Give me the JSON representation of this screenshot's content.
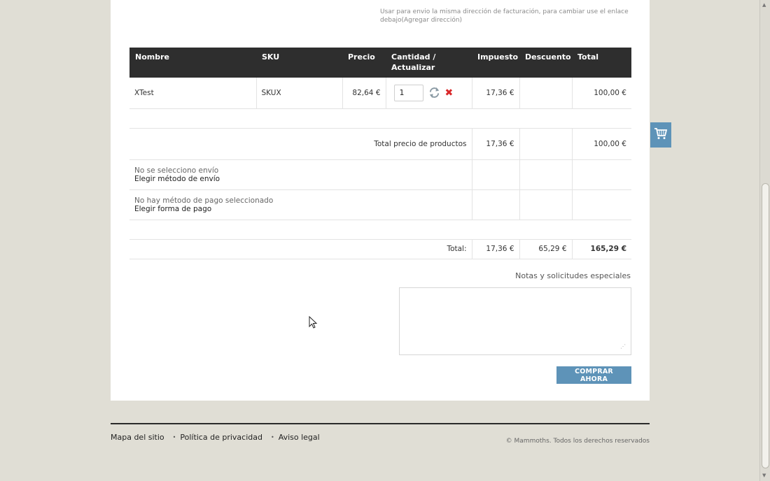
{
  "shipping_note": "Usar para envio la misma dirección de facturación, para cambiar use el enlace debajo(Agregar dirección)",
  "table": {
    "headers": {
      "name": "Nombre",
      "sku": "SKU",
      "price": "Precio",
      "qty_line1": "Cantidad /",
      "qty_line2": "Actualizar",
      "tax": "Impuesto",
      "discount": "Descuento",
      "total": "Total"
    },
    "item": {
      "name": "XTest",
      "sku": "SKUX",
      "price": "82,64 €",
      "quantity": "1",
      "tax": "17,36 €",
      "discount": "",
      "total": "100,00 €"
    },
    "products_total": {
      "label": "Total precio de productos",
      "tax": "17,36 €",
      "total": "100,00 €"
    },
    "shipping": {
      "status": "No se selecciono envío",
      "link": "Elegir método de envío"
    },
    "payment": {
      "status": "No hay método de pago seleccionado",
      "link": "Elegir forma de pago"
    },
    "grand_total": {
      "label": "Total:",
      "tax": "17,36 €",
      "discount": "65,29 €",
      "total": "165,29 €"
    }
  },
  "notes": {
    "label": "Notas y solicitudes especiales",
    "value": ""
  },
  "buy_button": "COMPRAR AHORA",
  "footer": {
    "links": [
      "Mapa del sitio",
      "Política de privacidad",
      "Aviso legal"
    ],
    "copyright": "© Mammoths. Todos los derechos reservados"
  },
  "colors": {
    "accent": "#5e93b8",
    "price_red": "#d9282a",
    "header_bg": "#2e2e2e",
    "page_bg": "#e0ded5"
  },
  "icons": [
    "refresh-icon",
    "remove-icon",
    "cart-icon",
    "resize-grip-icon",
    "mouse-cursor-icon"
  ]
}
